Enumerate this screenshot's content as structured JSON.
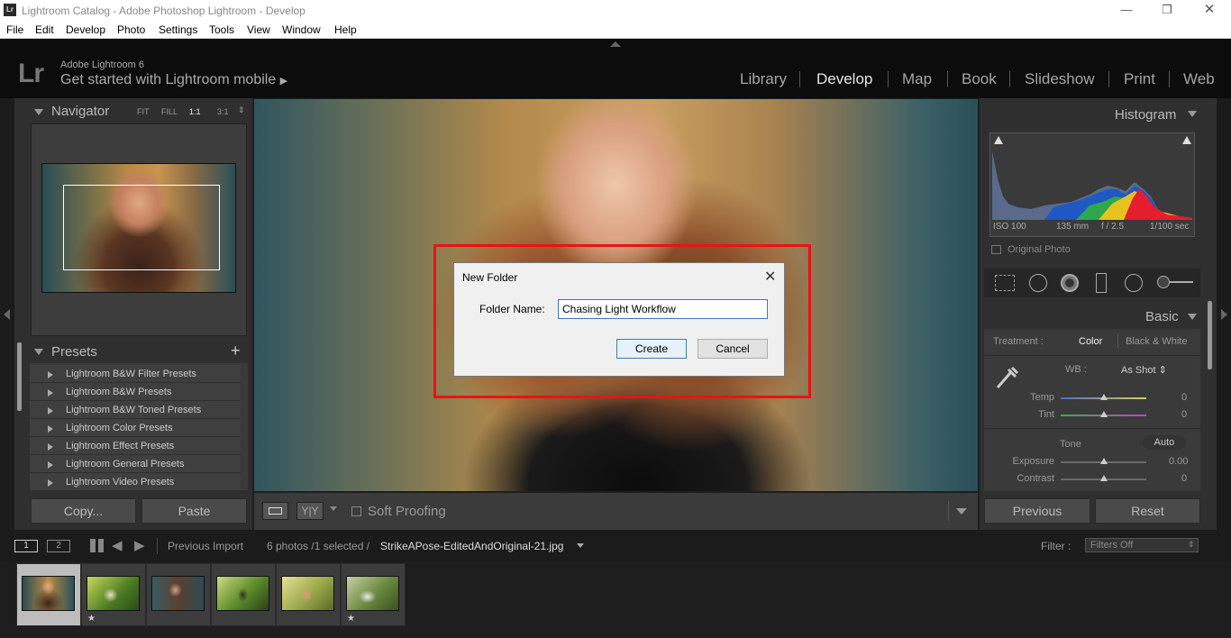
{
  "window": {
    "title": "Lightroom Catalog - Adobe Photoshop Lightroom - Develop",
    "lr_badge": "Lr"
  },
  "menu": [
    "File",
    "Edit",
    "Develop",
    "Photo",
    "Settings",
    "Tools",
    "View",
    "Window",
    "Help"
  ],
  "identity": {
    "logo": "Lr",
    "product": "Adobe Lightroom 6",
    "mobile": "Get started with Lightroom mobile"
  },
  "modules": {
    "library": "Library",
    "develop": "Develop",
    "map": "Map",
    "book": "Book",
    "slideshow": "Slideshow",
    "print": "Print",
    "web": "Web",
    "active": "Develop"
  },
  "navigator": {
    "title": "Navigator",
    "fit": "FIT",
    "fill": "FILL",
    "one": "1:1",
    "three": "3:1"
  },
  "presets": {
    "title": "Presets",
    "add": "+",
    "items": [
      "Lightroom B&W Filter Presets",
      "Lightroom B&W Presets",
      "Lightroom B&W Toned Presets",
      "Lightroom Color Presets",
      "Lightroom Effect Presets",
      "Lightroom General Presets",
      "Lightroom Video Presets"
    ]
  },
  "left_buttons": {
    "copy": "Copy...",
    "paste": "Paste"
  },
  "toolbar": {
    "soft_proofing": "Soft Proofing"
  },
  "dialog": {
    "title": "New Folder",
    "close": "✕",
    "label": "Folder Name:",
    "value": "Chasing Light Workflow",
    "create": "Create",
    "cancel": "Cancel"
  },
  "histogram": {
    "title": "Histogram",
    "iso": "ISO 100",
    "focal": "135 mm",
    "aperture": "f / 2.5",
    "shutter": "1/100 sec",
    "original": "Original Photo"
  },
  "basic": {
    "title": "Basic",
    "treatment_label": "Treatment :",
    "color": "Color",
    "bw": "Black & White",
    "wb_label": "WB :",
    "wb_value": "As Shot ⇕",
    "temp": "Temp",
    "temp_val": "0",
    "tint": "Tint",
    "tint_val": "0",
    "tone": "Tone",
    "auto": "Auto",
    "exposure": "Exposure",
    "exposure_val": "0.00",
    "contrast": "Contrast",
    "contrast_val": "0"
  },
  "right_buttons": {
    "previous": "Previous",
    "reset": "Reset"
  },
  "filmbar": {
    "view1": "1",
    "view2": "2",
    "source": "Previous Import",
    "count": "6 photos /1 selected /",
    "filename": "StrikeAPose-EditedAndOriginal-21.jpg",
    "filter_label": "Filter :",
    "filter_value": "Filters Off"
  },
  "filmstrip": {
    "star": "★"
  },
  "colors": {
    "accent_red": "#e11111",
    "dialog_button": "#e5f1fb"
  }
}
